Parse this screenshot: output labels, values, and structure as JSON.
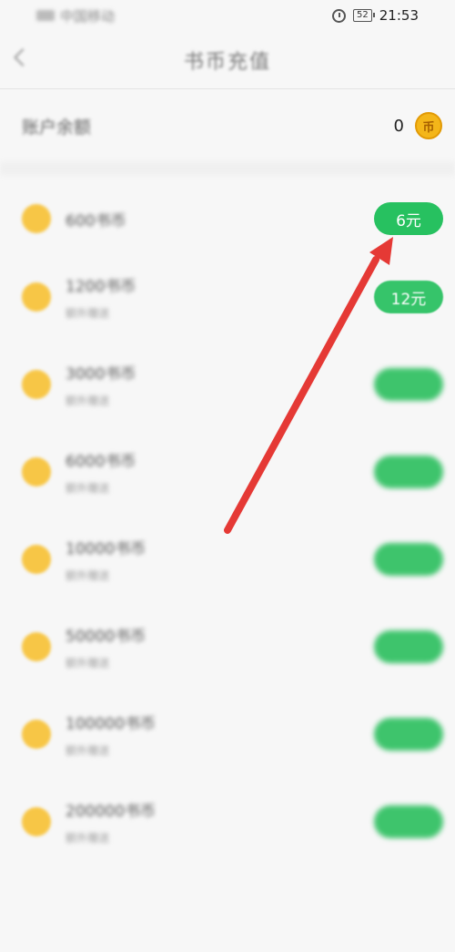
{
  "status_bar": {
    "carrier": "中国移动",
    "battery": "52",
    "time": "21:53"
  },
  "nav": {
    "title": "书币充值"
  },
  "balance": {
    "label": "账户余额",
    "value": "0",
    "coin_glyph": "币"
  },
  "items": [
    {
      "title": "600书币",
      "subtitle": "",
      "price": "6元"
    },
    {
      "title": "1200书币",
      "subtitle": "额外赠送",
      "price": "12元"
    },
    {
      "title": "3000书币",
      "subtitle": "额外赠送",
      "price": ""
    },
    {
      "title": "6000书币",
      "subtitle": "额外赠送",
      "price": ""
    },
    {
      "title": "10000书币",
      "subtitle": "额外赠送",
      "price": ""
    },
    {
      "title": "50000书币",
      "subtitle": "额外赠送",
      "price": ""
    },
    {
      "title": "100000书币",
      "subtitle": "额外赠送",
      "price": ""
    },
    {
      "title": "200000书币",
      "subtitle": "额外赠送",
      "price": ""
    }
  ],
  "colors": {
    "accent_green": "#27c160",
    "coin_yellow": "#f7c646",
    "arrow_red": "#e53935"
  }
}
